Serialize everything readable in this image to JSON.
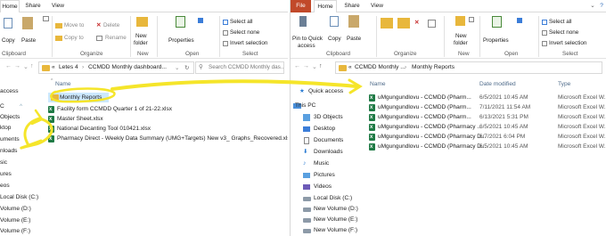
{
  "left": {
    "tabs": [
      "Home",
      "Share",
      "View"
    ],
    "ribbon": {
      "clipboard": {
        "copy": "Copy",
        "paste": "Paste",
        "label": "Clipboard"
      },
      "organize": {
        "move_to": "Move to",
        "copy_to": "Copy to",
        "delete": "Delete",
        "rename": "Rename",
        "label": "Organize"
      },
      "new": {
        "new_folder_line1": "New",
        "new_folder_line2": "folder",
        "label": "New"
      },
      "open": {
        "properties": "Properties",
        "label": "Open"
      },
      "select": {
        "select_all": "Select all",
        "select_none": "Select none",
        "invert": "Invert selection",
        "label": "Select"
      }
    },
    "breadcrumb": [
      "«",
      "Letes 4",
      "CCMDD Monthly dashboard..."
    ],
    "search_placeholder": "Search CCMDD Monthly das...",
    "nav": [
      "access",
      "C",
      "Objects",
      "ktop",
      "uments",
      "nloads",
      "sic",
      "ures",
      "eos",
      "Local Disk (C:)",
      "Volume (D:)",
      "Volume (E:)",
      "Volume (F:)"
    ],
    "column": "Name",
    "rows": [
      "Monthly Reports",
      "Facility form CCMDD Quarter 1 of 21-22.xlsx",
      "Master Sheet.xlsx",
      "National Decanting Tool 010421.xlsx",
      "Pharmacy Direct - Weekly Data Summary (UMG+Targets) New v3_ Graphs_Recovered.xlsx"
    ]
  },
  "right": {
    "tabs": [
      "File",
      "Home",
      "Share",
      "View"
    ],
    "ribbon": {
      "clipboard": {
        "pin": "Pin to Quick",
        "pin2": "access",
        "copy": "Copy",
        "paste": "Paste",
        "label": "Clipboard"
      },
      "organize": {
        "label": "Organize"
      },
      "new": {
        "new_folder_line1": "New",
        "new_folder_line2": "folder",
        "label": "New"
      },
      "open": {
        "properties": "Properties",
        "label": "Open"
      },
      "select": {
        "select_all": "Select all",
        "select_none": "Select none",
        "invert": "Invert selection",
        "label": "Select"
      }
    },
    "breadcrumb": [
      "«",
      "CCMDD Monthly ...",
      "Monthly Reports"
    ],
    "nav": [
      "Quick access",
      "This PC",
      "3D Objects",
      "Desktop",
      "Documents",
      "Downloads",
      "Music",
      "Pictures",
      "Videos",
      "Local Disk (C:)",
      "New Volume (D:)",
      "New Volume (E:)",
      "New Volume (F:)"
    ],
    "columns": [
      "Name",
      "Date modified",
      "Type"
    ],
    "rows": [
      [
        "uMgungundlovu - CCMDD (Pharm...",
        "6/5/2021 10:45 AM",
        "Microsoft Excel W..."
      ],
      [
        "uMgungundlovu - CCMDD (Pharm...",
        "7/11/2021 11:54 AM",
        "Microsoft Excel W..."
      ],
      [
        "uMgungundlovu - CCMDD (Pharm...",
        "6/13/2021 5:31 PM",
        "Microsoft Excel W..."
      ],
      [
        "uMgungundlovu - CCMDD (Pharmacy ...",
        "6/5/2021 10:45 AM",
        "Microsoft Excel W..."
      ],
      [
        "uMgungundlovu - CCMDD (Pharmacy D...",
        "6/7/2021 6:04 PM",
        "Microsoft Excel W..."
      ],
      [
        "uMgungundlovu - CCMDD (Pharmacy D...",
        "6/5/2021 10:45 AM",
        "Microsoft Excel W..."
      ]
    ]
  },
  "colors": {
    "highlighter": "#f5e52a",
    "excel": "#1f7a45",
    "folder": "#e8b73c",
    "file_tab": "#c1492a"
  }
}
